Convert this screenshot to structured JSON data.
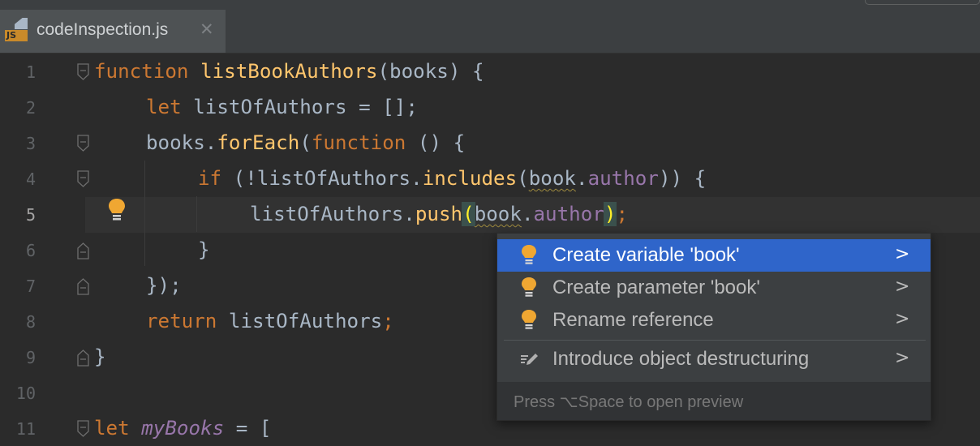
{
  "tab": {
    "file_badge": "JS",
    "title": "codeInspection.js",
    "close_glyph": "✕"
  },
  "gutter": {
    "line_numbers": [
      "1",
      "2",
      "3",
      "4",
      "5",
      "6",
      "7",
      "8",
      "9",
      "10",
      "11"
    ],
    "current_line": "5"
  },
  "code": {
    "l1": {
      "kw": "function",
      "name": "listBookAuthors",
      "rest": "(books) {"
    },
    "l2": {
      "kw": "let",
      "rest": " listOfAuthors = [];",
      "semi": ";"
    },
    "l3": {
      "obj": "books.",
      "method": "forEach",
      "p1": "(",
      "kw": "function",
      "rest": " () {"
    },
    "l4": {
      "kw": "if",
      "p1": " (!listOfAuthors.",
      "method": "includes",
      "p2": "(",
      "obj": "book",
      "dot": ".",
      "prop": "author",
      "p3": ")) {"
    },
    "l5": {
      "p1": "listOfAuthors.",
      "method": "push",
      "open": "(",
      "obj": "book",
      "dot": ".",
      "prop": "author",
      "close": ")",
      "semi": ";"
    },
    "l6": {
      "text": "}"
    },
    "l7": {
      "text": "});",
      "semi": ";"
    },
    "l8": {
      "kw": "return",
      "rest": " listOfAuthors",
      "semi": ";"
    },
    "l9": {
      "text": "}"
    },
    "l11": {
      "kw": "let",
      "sp": " ",
      "var": "myBooks",
      "rest": " = ["
    }
  },
  "popup": {
    "items": [
      {
        "label": "Create variable 'book'",
        "icon": "lightbulb-icon",
        "selected": true
      },
      {
        "label": "Create parameter 'book'",
        "icon": "lightbulb-icon"
      },
      {
        "label": "Rename reference",
        "icon": "lightbulb-icon"
      },
      {
        "label": "Introduce object destructuring",
        "icon": "pencil-icon"
      }
    ],
    "arrow": ">",
    "footer": "Press ⌥Space to open preview"
  },
  "colors": {
    "background": "#2b2b2b",
    "keyword": "#cc7832",
    "function": "#ffc66d",
    "property": "#9876aa",
    "selection": "#2f65ca",
    "bulb": "#f0a732"
  }
}
